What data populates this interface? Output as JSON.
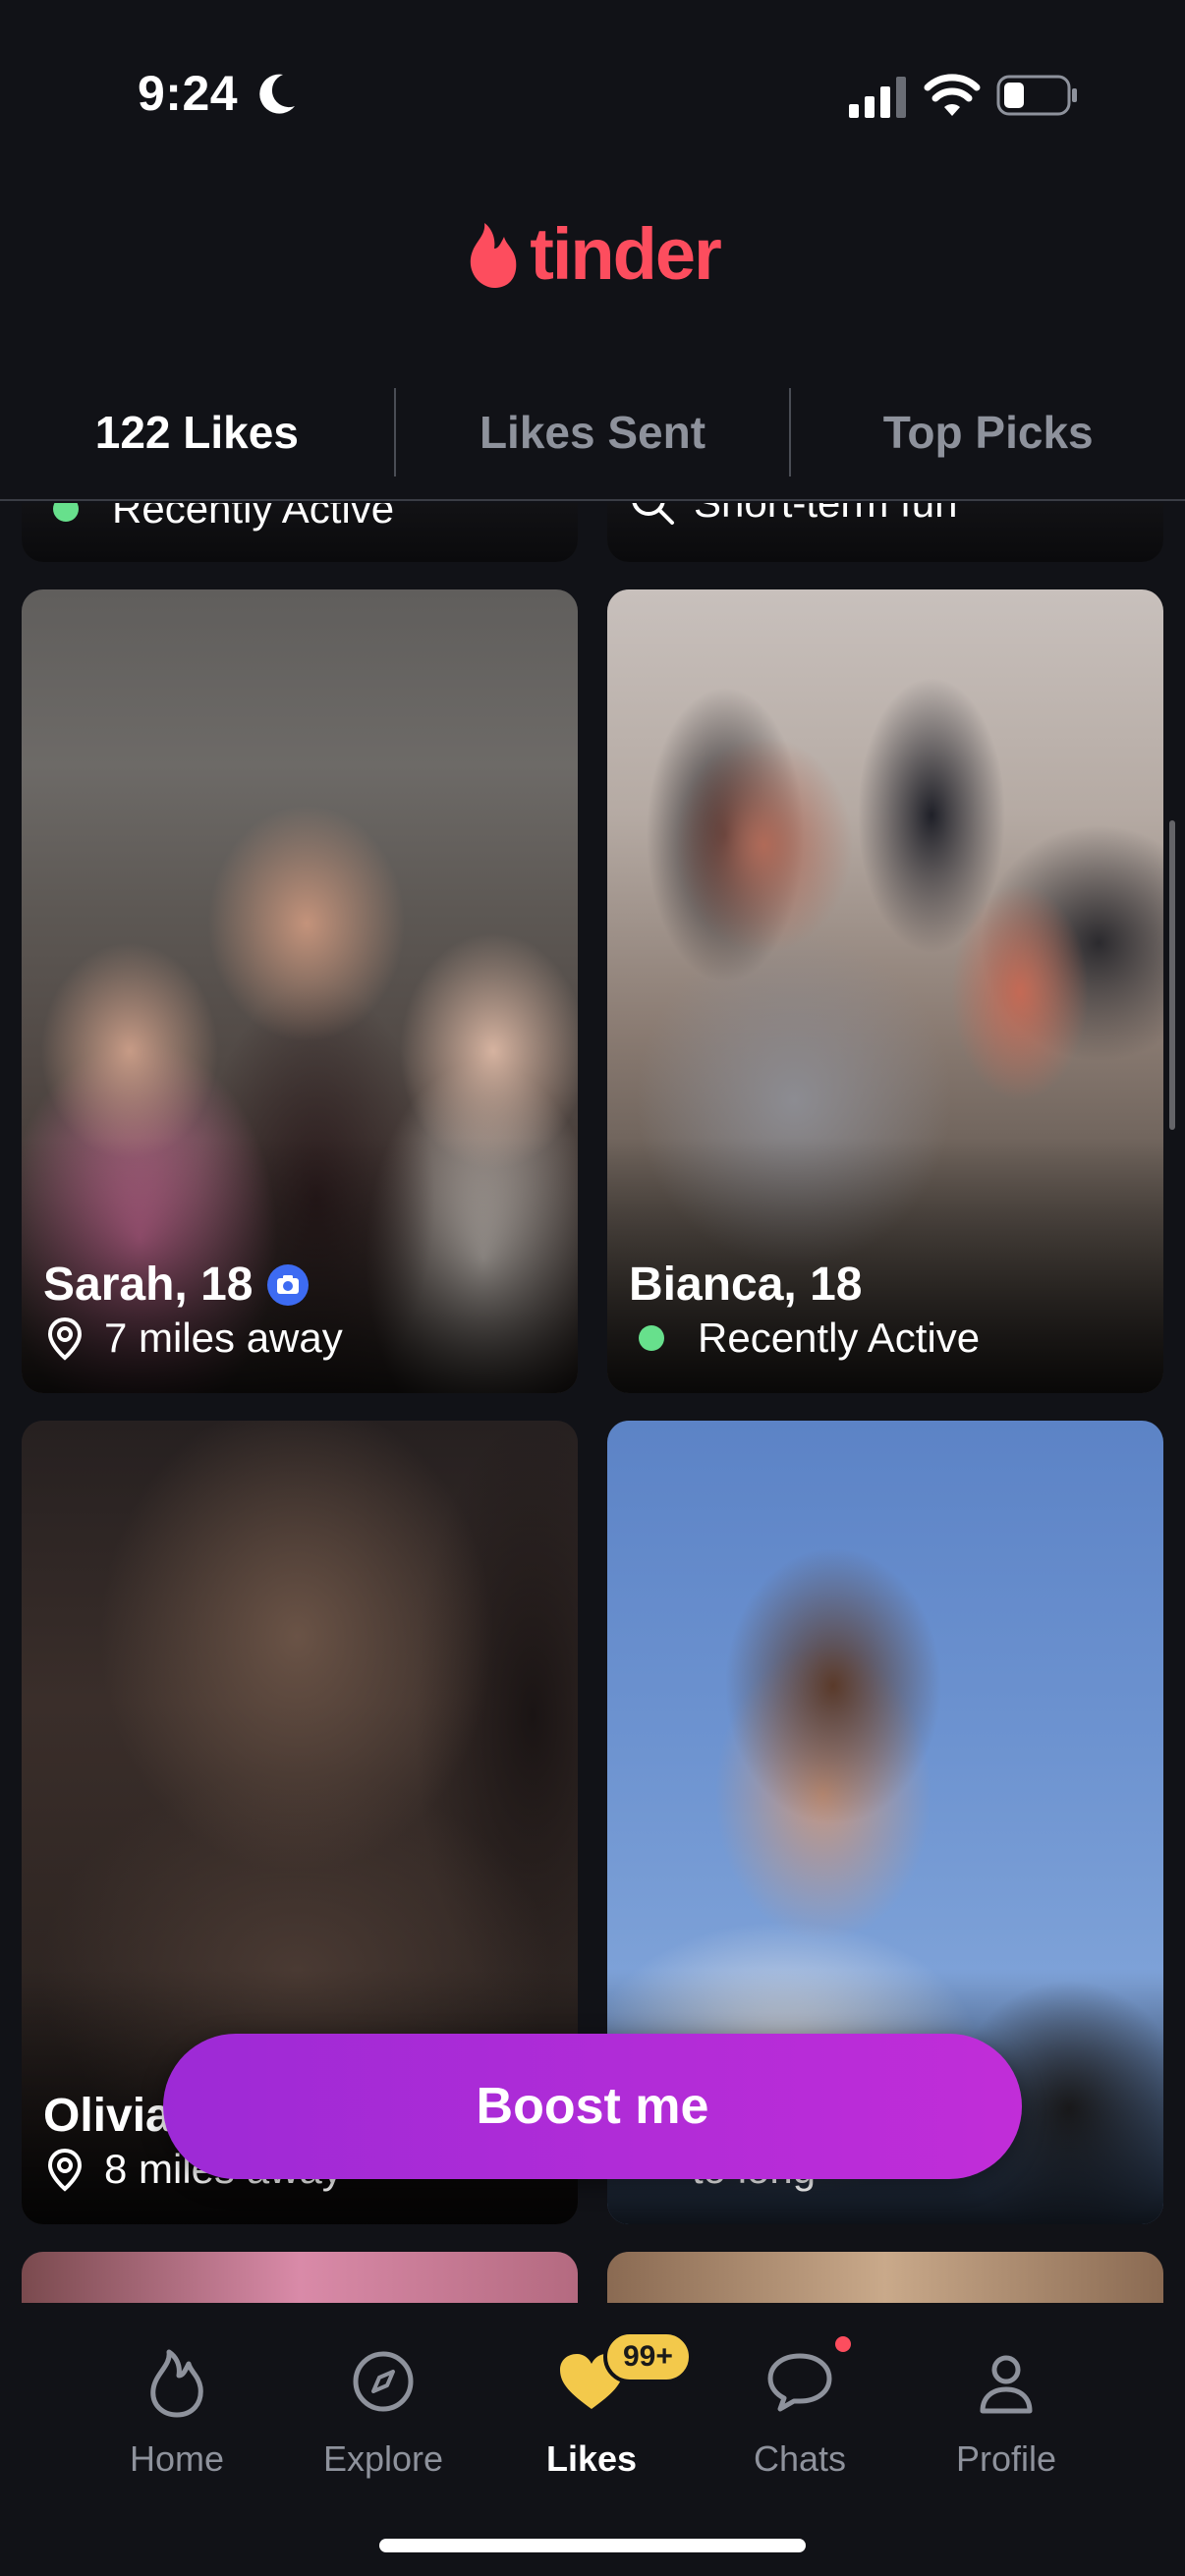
{
  "status_bar": {
    "time": "9:24"
  },
  "logo": {
    "text": "tinder"
  },
  "tabs": [
    {
      "label": "122 Likes",
      "active": true
    },
    {
      "label": "Likes Sent",
      "active": false
    },
    {
      "label": "Top Picks",
      "active": false
    }
  ],
  "top_partial_cards": {
    "left_status": "Recently Active",
    "right_intent": "Short-term fun"
  },
  "profiles": [
    {
      "name": "Sarah, 18",
      "verified": true,
      "detail": "7 miles away",
      "detail_type": "distance"
    },
    {
      "name": "Bianca, 18",
      "verified": false,
      "detail": "Recently Active",
      "detail_type": "active"
    },
    {
      "name": "Olivia",
      "verified": false,
      "detail": "8 miles away",
      "detail_type": "distance"
    },
    {
      "name": "",
      "verified": false,
      "detail": "to long",
      "detail_type": "intent"
    }
  ],
  "boost_button": {
    "label": "Boost me"
  },
  "bottom_nav": [
    {
      "label": "Home",
      "icon": "flame-icon"
    },
    {
      "label": "Explore",
      "icon": "compass-icon"
    },
    {
      "label": "Likes",
      "icon": "heart-icon",
      "active": true,
      "badge": "99+"
    },
    {
      "label": "Chats",
      "icon": "chat-bubble-icon",
      "notification_dot": true
    },
    {
      "label": "Profile",
      "icon": "person-icon"
    }
  ],
  "colors": {
    "brand": "#fd4d5e",
    "background": "#111217",
    "boost_start": "#9d2ad6",
    "boost_end": "#c12dd8",
    "active_dot": "#67e08c",
    "badge": "#f3c94b"
  }
}
